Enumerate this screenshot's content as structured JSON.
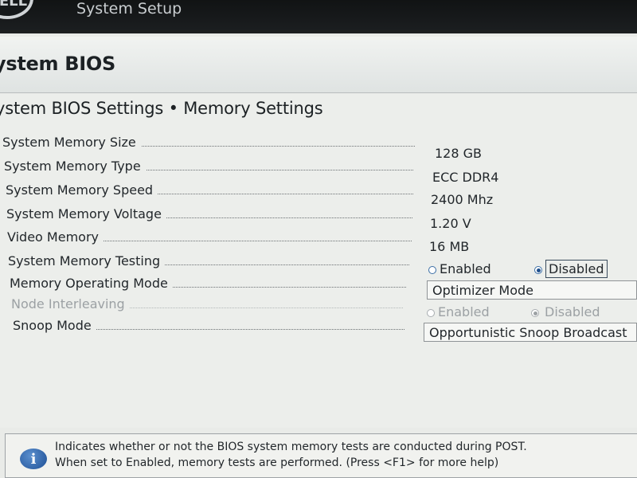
{
  "header": {
    "title": "System Setup",
    "logo_text": "DELL"
  },
  "section": {
    "title": "ystem BIOS"
  },
  "page": {
    "title": "ystem BIOS Settings • Memory Settings"
  },
  "settings": [
    {
      "label": "System Memory Size",
      "value": "128 GB"
    },
    {
      "label": "System Memory Type",
      "value": "ECC DDR4"
    },
    {
      "label": "System Memory Speed",
      "value": "2400 Mhz"
    },
    {
      "label": "System Memory Voltage",
      "value": "1.20 V"
    },
    {
      "label": "Video Memory",
      "value": "16 MB"
    },
    {
      "label": "System Memory Testing",
      "options": [
        "Enabled",
        "Disabled"
      ],
      "selected": "Disabled"
    },
    {
      "label": "Memory Operating Mode",
      "value": "Optimizer Mode"
    },
    {
      "label": "Node Interleaving",
      "options": [
        "Enabled",
        "Disabled"
      ],
      "selected": "Disabled",
      "disabled": true
    },
    {
      "label": "Snoop Mode",
      "value": "Opportunistic Snoop Broadcast"
    }
  ],
  "help": {
    "line1": "Indicates whether or not the BIOS system memory tests are conducted during POST.",
    "line2": "When set to Enabled, memory tests are performed. (Press <F1> for more help)",
    "icon": "info-icon"
  }
}
